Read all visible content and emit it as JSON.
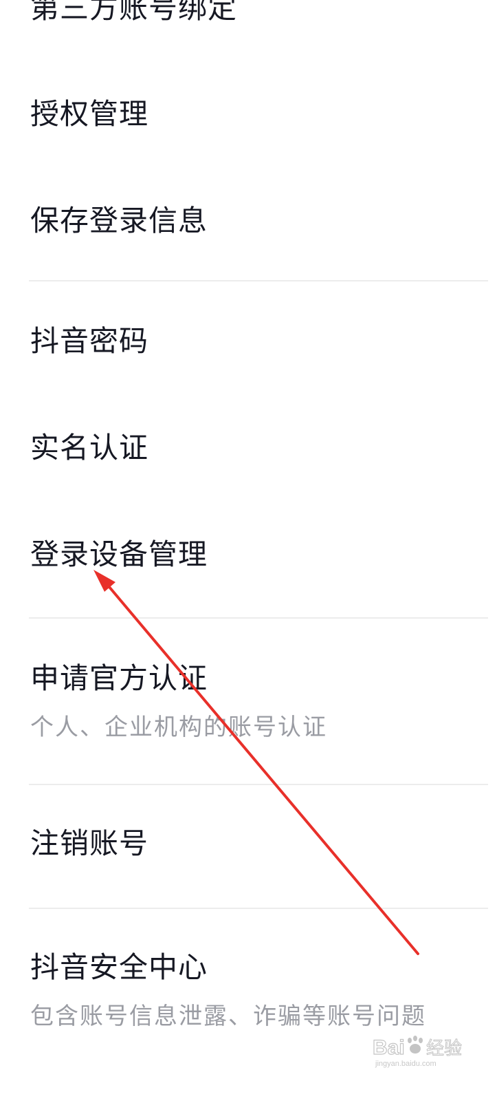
{
  "settings_list": {
    "items": [
      {
        "title": "第三方账号绑定"
      },
      {
        "title": "授权管理"
      },
      {
        "title": "保存登录信息"
      },
      {
        "title": "抖音密码"
      },
      {
        "title": "实名认证"
      },
      {
        "title": "登录设备管理"
      },
      {
        "title": "申请官方认证",
        "subtitle": "个人、企业机构的账号认证"
      },
      {
        "title": "注销账号"
      },
      {
        "title": "抖音安全中心",
        "subtitle": "包含账号信息泄露、诈骗等账号问题"
      }
    ]
  },
  "annotation": {
    "arrow_color": "#e8302a",
    "arrow_points_to": "登录设备管理"
  },
  "watermark": {
    "brand": "Baidu经验",
    "url": "jingyan.baidu.com"
  }
}
